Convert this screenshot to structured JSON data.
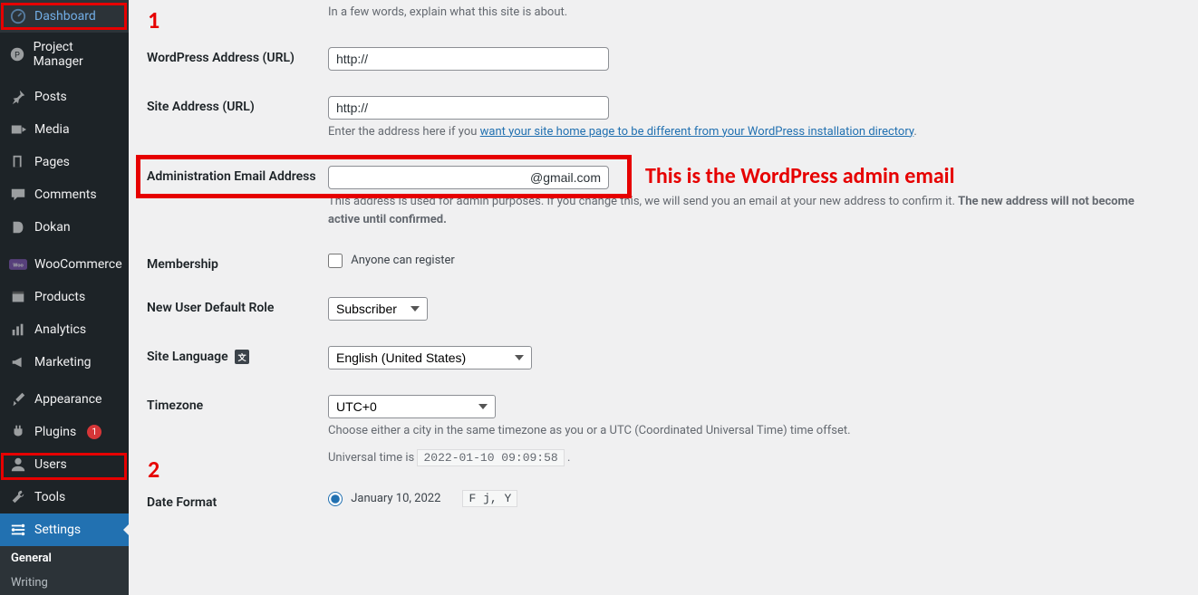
{
  "sidebar": {
    "items": [
      {
        "label": "Dashboard",
        "icon": "dashboard"
      },
      {
        "label": "Project Manager",
        "icon": "project"
      },
      {
        "label": "Posts",
        "icon": "posts"
      },
      {
        "label": "Media",
        "icon": "media"
      },
      {
        "label": "Pages",
        "icon": "pages"
      },
      {
        "label": "Comments",
        "icon": "comments"
      },
      {
        "label": "Dokan",
        "icon": "dokan"
      },
      {
        "label": "WooCommerce",
        "icon": "woo"
      },
      {
        "label": "Products",
        "icon": "products"
      },
      {
        "label": "Analytics",
        "icon": "analytics"
      },
      {
        "label": "Marketing",
        "icon": "marketing"
      },
      {
        "label": "Appearance",
        "icon": "appearance"
      },
      {
        "label": "Plugins",
        "icon": "plugins",
        "badge": "1"
      },
      {
        "label": "Users",
        "icon": "users"
      },
      {
        "label": "Tools",
        "icon": "tools"
      },
      {
        "label": "Settings",
        "icon": "settings",
        "current": true
      }
    ],
    "submenu": [
      {
        "label": "General",
        "active": true
      },
      {
        "label": "Writing"
      }
    ]
  },
  "form": {
    "tagline_desc": "In a few words, explain what this site is about.",
    "wp_url_label": "WordPress Address (URL)",
    "wp_url_value": "http://",
    "site_url_label": "Site Address (URL)",
    "site_url_value": "http://",
    "site_url_desc_pre": "Enter the address here if you ",
    "site_url_desc_link": "want your site home page to be different from your WordPress installation directory",
    "admin_email_label": "Administration Email Address",
    "admin_email_value": "@gmail.com",
    "admin_email_desc_pre": "This address is used for admin purposes. If you change this, we will send you an email at your new address to confirm it. ",
    "admin_email_desc_strong": "The new address will not become active until confirmed.",
    "membership_label": "Membership",
    "membership_checkbox": "Anyone can register",
    "default_role_label": "New User Default Role",
    "default_role_value": "Subscriber",
    "site_language_label": "Site Language",
    "site_language_value": "English (United States)",
    "timezone_label": "Timezone",
    "timezone_value": "UTC+0",
    "timezone_desc": "Choose either a city in the same timezone as you or a UTC (Coordinated Universal Time) time offset.",
    "universal_time_pre": "Universal time is ",
    "universal_time_code": "2022-01-10 09:09:58",
    "date_format_label": "Date Format",
    "date_format_example": "January 10, 2022",
    "date_format_code": "F j, Y"
  },
  "annotations": {
    "n1": "1",
    "n2": "2",
    "admin_email_note": "This is the WordPress admin email"
  }
}
